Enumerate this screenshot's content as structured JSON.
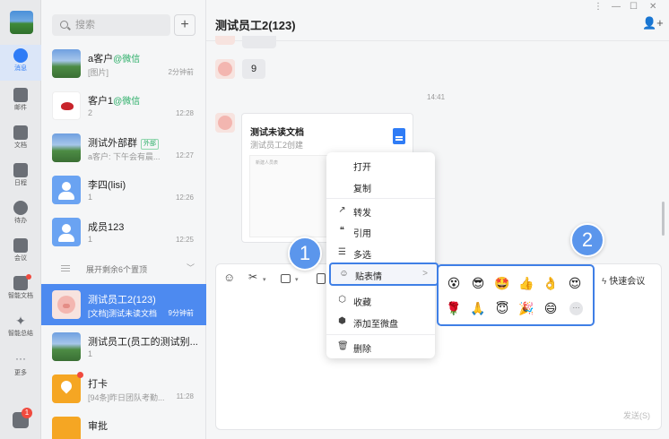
{
  "rail": {
    "items": [
      {
        "label": "消息",
        "icon": "chat-icon"
      },
      {
        "label": "邮件",
        "icon": "mail-icon"
      },
      {
        "label": "文档",
        "icon": "doc-icon"
      },
      {
        "label": "日程",
        "icon": "calendar-icon"
      },
      {
        "label": "待办",
        "icon": "todo-icon"
      },
      {
        "label": "会议",
        "icon": "meeting-icon"
      },
      {
        "label": "智能文档",
        "icon": "smart-doc-icon"
      },
      {
        "label": "智能总结",
        "icon": "sparkle-icon"
      },
      {
        "label": "更多",
        "icon": "more-icon"
      }
    ],
    "bottom_badge": "1"
  },
  "search": {
    "placeholder": "搜索",
    "plus": "+"
  },
  "conversations": [
    {
      "name": "a客户",
      "tag": "@微信",
      "sub": "[图片]",
      "time": "2分钟前"
    },
    {
      "name": "客户1",
      "tag": "@微信",
      "sub": "2",
      "time": "12:28"
    },
    {
      "name": "测试外部群",
      "tag_box": "外部",
      "sub": "a客户: 下午会有晨...",
      "time": "12:27"
    },
    {
      "name": "李四(lisi)",
      "sub": "1",
      "time": "12:26"
    },
    {
      "name": "成员123",
      "sub": "1",
      "time": "12:25"
    },
    {
      "name": "测试员工2(123)",
      "sub": "[文档]测试未读文档",
      "time": "9分钟前"
    },
    {
      "name": "测试员工(员工的测试别...",
      "sub": "1",
      "time": ""
    },
    {
      "name": "打卡",
      "sub": "[94条]昨日团队考勤...",
      "time": "11:28"
    },
    {
      "name": "审批",
      "sub": "",
      "time": ""
    }
  ],
  "expand": {
    "label": "展开剩余6个置顶",
    "chevron": "﹀"
  },
  "chat": {
    "title": "测试员工2(123)",
    "window_controls": [
      "⋮",
      "—",
      "☐",
      "✕"
    ],
    "add_member": "👤+",
    "messages": [
      {
        "text": "9"
      }
    ],
    "timestamp": "14:41",
    "doc_card": {
      "title": "测试未读文档",
      "subtitle": "测试员工2创建",
      "preview_text": "新建人员表"
    },
    "toolbar": {
      "emoji": "☺",
      "scissors": "✂",
      "meeting_label": "快速会议",
      "bolt": "ϟ"
    },
    "send_label": "发送(S)"
  },
  "menu": {
    "items": [
      {
        "label": "打开"
      },
      {
        "label": "复制"
      },
      {
        "label": "转发",
        "icon": "↗"
      },
      {
        "label": "引用",
        "icon": "❝"
      },
      {
        "label": "多选",
        "icon": "☰"
      },
      {
        "label": "贴表情",
        "icon": "☺",
        "chevron": ">"
      },
      {
        "label": "收藏",
        "icon": "⬡"
      },
      {
        "label": "添加至微盘",
        "icon": "⬢"
      },
      {
        "label": "删除",
        "icon": "🗑"
      }
    ]
  },
  "emoji_popup": {
    "row1": [
      "😵",
      "😎",
      "🤩",
      "👍",
      "👌",
      "😍"
    ],
    "row2": [
      "🌹",
      "🙏",
      "😇",
      "🎉",
      "😄"
    ],
    "more": "···"
  },
  "callouts": [
    "1",
    "2"
  ]
}
